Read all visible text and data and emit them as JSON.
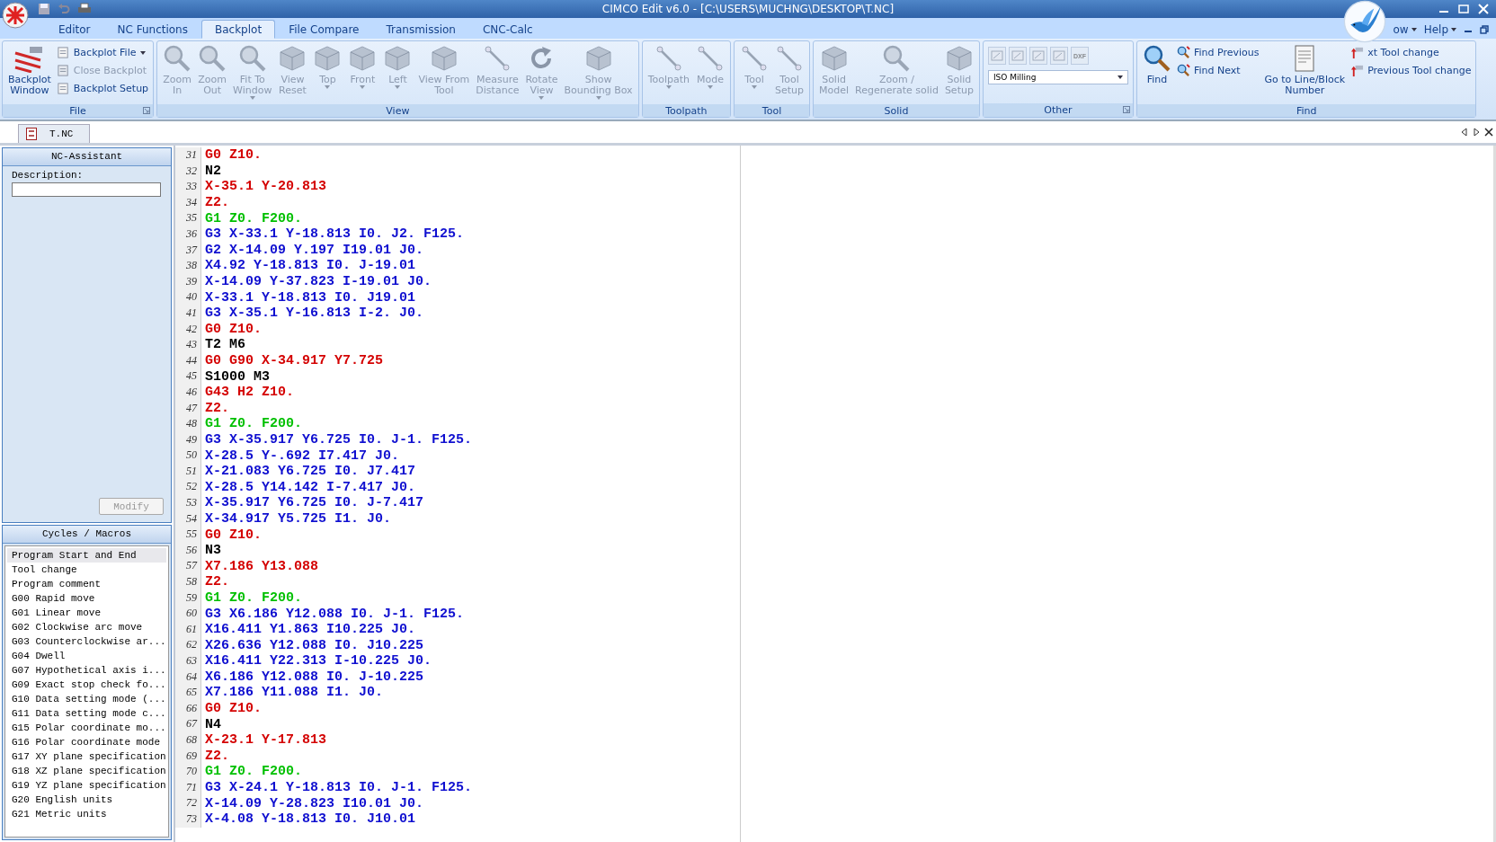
{
  "window": {
    "title": "CIMCO Edit v6.0 - [C:\\USERS\\MUCHNG\\DESKTOP\\T.NC]"
  },
  "menu_tabs": [
    {
      "label": "Editor",
      "selected": false
    },
    {
      "label": "NC Functions",
      "selected": false
    },
    {
      "label": "Backplot",
      "selected": true
    },
    {
      "label": "File Compare",
      "selected": false
    },
    {
      "label": "Transmission",
      "selected": false
    },
    {
      "label": "CNC-Calc",
      "selected": false
    }
  ],
  "menu_right": [
    {
      "label": "ow",
      "dropdown": true
    },
    {
      "label": "Help",
      "dropdown": true
    }
  ],
  "ribbon": {
    "groups": [
      {
        "label": "File",
        "launcher": true,
        "large": [
          {
            "label": "Backplot\nWindow",
            "disabled": false,
            "dropdown": false
          }
        ],
        "small": [
          {
            "label": "Backplot File",
            "disabled": false,
            "dropdown": true
          },
          {
            "label": "Close Backplot",
            "disabled": true,
            "dropdown": false
          },
          {
            "label": "Backplot Setup",
            "disabled": false,
            "dropdown": false
          }
        ]
      },
      {
        "label": "View",
        "launcher": false,
        "large": [
          {
            "label": "Zoom\nIn",
            "disabled": true,
            "dropdown": false
          },
          {
            "label": "Zoom\nOut",
            "disabled": true,
            "dropdown": false
          },
          {
            "label": "Fit To\nWindow",
            "disabled": true,
            "dropdown": true
          },
          {
            "label": "View\nReset",
            "disabled": true,
            "dropdown": false
          },
          {
            "label": "Top",
            "disabled": true,
            "dropdown": true
          },
          {
            "label": "Front",
            "disabled": true,
            "dropdown": true
          },
          {
            "label": "Left",
            "disabled": true,
            "dropdown": true
          },
          {
            "label": "View From\nTool",
            "disabled": true,
            "dropdown": false
          },
          {
            "label": "Measure\nDistance",
            "disabled": true,
            "dropdown": false
          },
          {
            "label": "Rotate\nView",
            "disabled": true,
            "dropdown": true
          },
          {
            "label": "Show\nBounding Box",
            "disabled": true,
            "dropdown": true
          }
        ]
      },
      {
        "label": "Toolpath",
        "launcher": false,
        "large": [
          {
            "label": "Toolpath",
            "disabled": true,
            "dropdown": true
          },
          {
            "label": "Mode",
            "disabled": true,
            "dropdown": true
          }
        ]
      },
      {
        "label": "Tool",
        "launcher": false,
        "large": [
          {
            "label": "Tool",
            "disabled": true,
            "dropdown": true
          },
          {
            "label": "Tool\nSetup",
            "disabled": true,
            "dropdown": false
          }
        ]
      },
      {
        "label": "Solid",
        "launcher": false,
        "large": [
          {
            "label": "Solid\nModel",
            "disabled": true,
            "dropdown": false
          },
          {
            "label": "Zoom /\nRegenerate solid",
            "disabled": true,
            "dropdown": false
          },
          {
            "label": "Solid\nSetup",
            "disabled": true,
            "dropdown": false
          }
        ]
      },
      {
        "label": "Other",
        "launcher": true,
        "toolbar": [
          {
            "disabled": true
          },
          {
            "disabled": true
          },
          {
            "disabled": true
          },
          {
            "disabled": true
          },
          {
            "disabled": true,
            "label": "DXF"
          }
        ],
        "select": {
          "value": "ISO Milling"
        }
      },
      {
        "label": "Find",
        "launcher": false,
        "large": [
          {
            "label": "Find",
            "disabled": false,
            "dropdown": false
          }
        ],
        "small": [
          {
            "label": "Find Previous",
            "disabled": false,
            "dropdown": false
          },
          {
            "label": "Find Next",
            "disabled": false,
            "dropdown": false
          }
        ],
        "large2": [
          {
            "label": "Go to Line/Block\nNumber",
            "disabled": false,
            "dropdown": false
          }
        ],
        "small2": [
          {
            "label": "xt Tool change",
            "disabled": false
          },
          {
            "label": "Previous Tool change",
            "disabled": false
          }
        ]
      }
    ]
  },
  "doc_tabs": [
    {
      "label": "T.NC",
      "selected": true
    }
  ],
  "nc_assistant": {
    "title": "NC-Assistant",
    "description_label": "Description:",
    "button": {
      "label": "Modify",
      "disabled": true
    }
  },
  "cycles": {
    "title": "Cycles / Macros",
    "items": [
      {
        "label": "Program Start and End",
        "selected": true
      },
      {
        "label": "Tool change",
        "selected": false
      },
      {
        "label": "Program comment",
        "selected": false
      },
      {
        "label": "G00 Rapid move",
        "selected": false
      },
      {
        "label": "G01 Linear move",
        "selected": false
      },
      {
        "label": "G02 Clockwise arc move",
        "selected": false
      },
      {
        "label": "G03 Counterclockwise ar...",
        "selected": false
      },
      {
        "label": "G04 Dwell",
        "selected": false
      },
      {
        "label": "G07 Hypothetical axis i...",
        "selected": false
      },
      {
        "label": "G09 Exact stop check fo...",
        "selected": false
      },
      {
        "label": "G10 Data setting mode (...",
        "selected": false
      },
      {
        "label": "G11 Data setting mode c...",
        "selected": false
      },
      {
        "label": "G15 Polar coordinate mo...",
        "selected": false
      },
      {
        "label": "G16 Polar coordinate mode",
        "selected": false
      },
      {
        "label": "G17 XY plane specification",
        "selected": false
      },
      {
        "label": "G18 XZ plane specification",
        "selected": false
      },
      {
        "label": "G19 YZ plane specification",
        "selected": false
      },
      {
        "label": "G20 English units",
        "selected": false
      },
      {
        "label": "G21 Metric units",
        "selected": false
      }
    ]
  },
  "editor": {
    "lines": [
      {
        "number": "31",
        "text": "G0 Z10.",
        "kind": "rapid"
      },
      {
        "number": "32",
        "text": "N2",
        "kind": "plain"
      },
      {
        "number": "33",
        "text": "X-35.1 Y-20.813",
        "kind": "rapid"
      },
      {
        "number": "34",
        "text": "Z2.",
        "kind": "rapid"
      },
      {
        "number": "35",
        "text": "G1 Z0. F200.",
        "kind": "linear"
      },
      {
        "number": "36",
        "text": "G3 X-33.1 Y-18.813 I0. J2. F125.",
        "kind": "arc"
      },
      {
        "number": "37",
        "text": "G2 X-14.09 Y.197 I19.01 J0.",
        "kind": "arc"
      },
      {
        "number": "38",
        "text": "X4.92 Y-18.813 I0. J-19.01",
        "kind": "arc"
      },
      {
        "number": "39",
        "text": "X-14.09 Y-37.823 I-19.01 J0.",
        "kind": "arc"
      },
      {
        "number": "40",
        "text": "X-33.1 Y-18.813 I0. J19.01",
        "kind": "arc"
      },
      {
        "number": "41",
        "text": "G3 X-35.1 Y-16.813 I-2. J0.",
        "kind": "arc"
      },
      {
        "number": "42",
        "text": "G0 Z10.",
        "kind": "rapid"
      },
      {
        "number": "43",
        "text": "T2 M6",
        "kind": "plain"
      },
      {
        "number": "44",
        "text": "G0 G90 X-34.917 Y7.725",
        "kind": "rapid"
      },
      {
        "number": "45",
        "text": "S1000 M3",
        "kind": "plain"
      },
      {
        "number": "46",
        "text": "G43 H2 Z10.",
        "kind": "rapid"
      },
      {
        "number": "47",
        "text": "Z2.",
        "kind": "rapid"
      },
      {
        "number": "48",
        "text": "G1 Z0. F200.",
        "kind": "linear"
      },
      {
        "number": "49",
        "text": "G3 X-35.917 Y6.725 I0. J-1. F125.",
        "kind": "arc"
      },
      {
        "number": "50",
        "text": "X-28.5 Y-.692 I7.417 J0.",
        "kind": "arc"
      },
      {
        "number": "51",
        "text": "X-21.083 Y6.725 I0. J7.417",
        "kind": "arc"
      },
      {
        "number": "52",
        "text": "X-28.5 Y14.142 I-7.417 J0.",
        "kind": "arc"
      },
      {
        "number": "53",
        "text": "X-35.917 Y6.725 I0. J-7.417",
        "kind": "arc"
      },
      {
        "number": "54",
        "text": "X-34.917 Y5.725 I1. J0.",
        "kind": "arc"
      },
      {
        "number": "55",
        "text": "G0 Z10.",
        "kind": "rapid"
      },
      {
        "number": "56",
        "text": "N3",
        "kind": "plain"
      },
      {
        "number": "57",
        "text": "X7.186 Y13.088",
        "kind": "rapid"
      },
      {
        "number": "58",
        "text": "Z2.",
        "kind": "rapid"
      },
      {
        "number": "59",
        "text": "G1 Z0. F200.",
        "kind": "linear"
      },
      {
        "number": "60",
        "text": "G3 X6.186 Y12.088 I0. J-1. F125.",
        "kind": "arc"
      },
      {
        "number": "61",
        "text": "X16.411 Y1.863 I10.225 J0.",
        "kind": "arc"
      },
      {
        "number": "62",
        "text": "X26.636 Y12.088 I0. J10.225",
        "kind": "arc"
      },
      {
        "number": "63",
        "text": "X16.411 Y22.313 I-10.225 J0.",
        "kind": "arc"
      },
      {
        "number": "64",
        "text": "X6.186 Y12.088 I0. J-10.225",
        "kind": "arc"
      },
      {
        "number": "65",
        "text": "X7.186 Y11.088 I1. J0.",
        "kind": "arc"
      },
      {
        "number": "66",
        "text": "G0 Z10.",
        "kind": "rapid"
      },
      {
        "number": "67",
        "text": "N4",
        "kind": "plain"
      },
      {
        "number": "68",
        "text": "X-23.1 Y-17.813",
        "kind": "rapid"
      },
      {
        "number": "69",
        "text": "Z2.",
        "kind": "rapid"
      },
      {
        "number": "70",
        "text": "G1 Z0. F200.",
        "kind": "linear"
      },
      {
        "number": "71",
        "text": "G3 X-24.1 Y-18.813 I0. J-1. F125.",
        "kind": "arc"
      },
      {
        "number": "72",
        "text": "X-14.09 Y-28.823 I10.01 J0.",
        "kind": "arc"
      },
      {
        "number": "73",
        "text": "X-4.08 Y-18.813 I0. J10.01",
        "kind": "arc"
      }
    ]
  }
}
